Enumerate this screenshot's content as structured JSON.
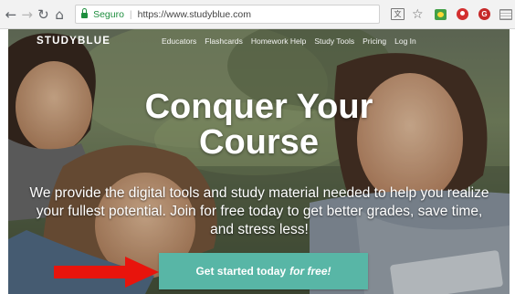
{
  "browser": {
    "back_icon": "←",
    "forward_icon": "→",
    "reload_icon": "↻",
    "home_icon": "⌂",
    "secure_label": "Seguro",
    "url": "https://www.studyblue.com",
    "extensions": [
      "translate-icon",
      "bookmark-star-icon",
      "green-extension-icon",
      "red-extension-icon",
      "red-extension-icon-2",
      "menu-icon"
    ]
  },
  "site": {
    "logo": "STUDYBLUE",
    "nav": [
      "Educators",
      "Flashcards",
      "Homework Help",
      "Study Tools",
      "Pricing",
      "Log In"
    ],
    "headline_line1": "Conquer Your",
    "headline_line2": "Course",
    "subtext": "We provide the digital tools and study material needed to help you realize your fullest potential. Join for free today to get better grades, save time, and stress less!",
    "cta_main": "Get started today",
    "cta_italic": "for free!",
    "accent_color": "#58b6a6",
    "arrow_color": "#e8140c"
  }
}
